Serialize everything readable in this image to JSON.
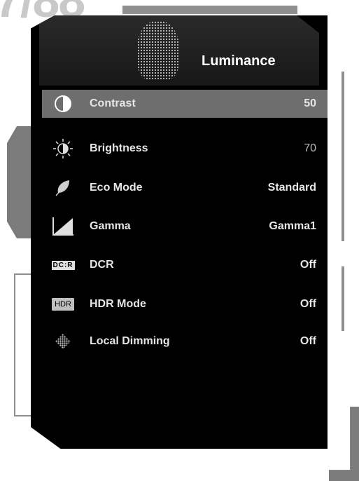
{
  "header": {
    "title": "Luminance",
    "icon": "bulb-dots-icon"
  },
  "menu": {
    "items": [
      {
        "label": "Contrast",
        "value": "50",
        "icon": "contrast-icon",
        "selected": true
      },
      {
        "label": "Brightness",
        "value": "70",
        "icon": "sun-icon",
        "selected": false
      },
      {
        "label": "Eco Mode",
        "value": "Standard",
        "icon": "leaf-icon",
        "selected": false
      },
      {
        "label": "Gamma",
        "value": "Gamma1",
        "icon": "gamma-curve-icon",
        "selected": false
      },
      {
        "label": "DCR",
        "value": "Off",
        "icon": "dcr-icon",
        "icon_text": "DC:R",
        "selected": false
      },
      {
        "label": "HDR Mode",
        "value": "Off",
        "icon": "hdr-icon",
        "icon_text": "HDR",
        "selected": false
      },
      {
        "label": "Local Dimming",
        "value": "Off",
        "icon": "local-dimming-icon",
        "selected": false
      }
    ]
  },
  "colors": {
    "panel": "#000000",
    "selected": "#6e6e6e",
    "text": "#e6e6e6"
  }
}
